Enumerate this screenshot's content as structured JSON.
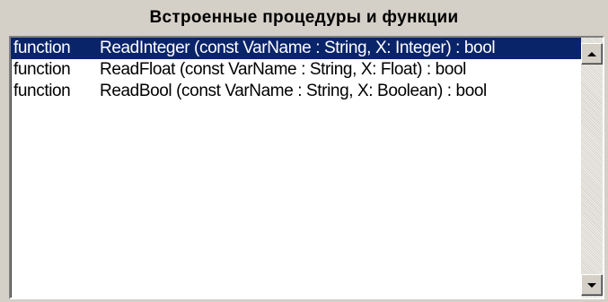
{
  "panel": {
    "title": "Встроенные процедуры и функции"
  },
  "list": {
    "items": [
      {
        "keyword": "function",
        "signature": "ReadInteger (const VarName : String, X: Integer) : bool",
        "selected": true
      },
      {
        "keyword": "function",
        "signature": "ReadFloat (const VarName : String, X: Float)  : bool",
        "selected": false
      },
      {
        "keyword": "function",
        "signature": "ReadBool (const VarName : String, X: Boolean)  : bool",
        "selected": false
      }
    ]
  },
  "scrollbar": {
    "up_icon": "arrow-up-icon",
    "down_icon": "arrow-down-icon"
  },
  "colors": {
    "selection_bg": "#0a246a",
    "selection_text": "#ffffff",
    "panel_bg": "#d4d0c8"
  }
}
